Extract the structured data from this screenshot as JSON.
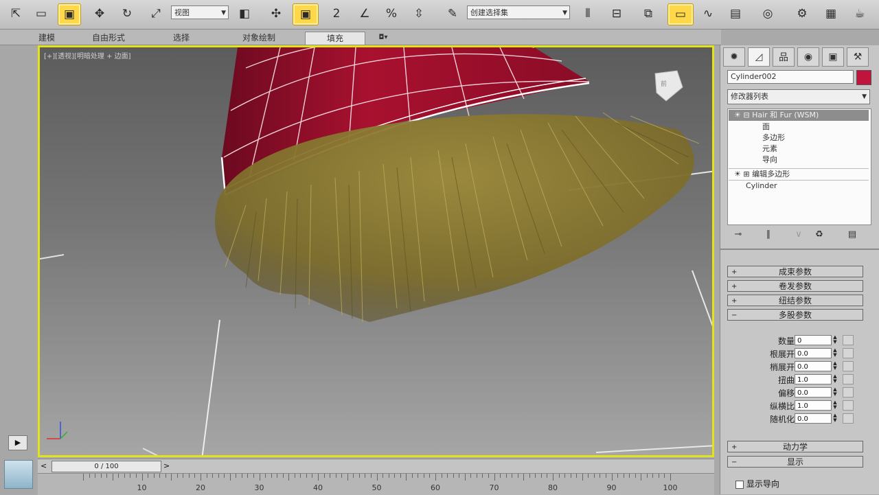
{
  "toolbar": {
    "view_dropdown": "视图",
    "selection_set": "创建选择集",
    "snap_label": "2",
    "percent_label": "%"
  },
  "ribbon": {
    "tabs": [
      "建模",
      "自由形式",
      "选择",
      "对象绘制",
      "填充"
    ]
  },
  "viewport": {
    "label": "[+][透视][明暗处理 + 边面]",
    "viewcube_label": "前"
  },
  "timeline": {
    "frame_display": "0 / 100",
    "ticks": [
      "10",
      "20",
      "30",
      "40",
      "50",
      "60",
      "70",
      "80",
      "90",
      "100"
    ]
  },
  "panel": {
    "object_name": "Cylinder002",
    "object_color": "#c0143c",
    "modifier_list": "修改器列表",
    "stack": {
      "hair_modifier": "Hair 和 Fur (WSM)",
      "sub_items": [
        "面",
        "多边形",
        "元素",
        "导向"
      ],
      "edit_poly": "编辑多边形",
      "base": "Cylinder"
    },
    "rollouts": [
      "成束参数",
      "卷发参数",
      "纽结参数",
      "多股参数"
    ],
    "params": [
      {
        "label": "数量",
        "value": "0"
      },
      {
        "label": "根展开",
        "value": "0.0"
      },
      {
        "label": "梢展开",
        "value": "0.0"
      },
      {
        "label": "扭曲",
        "value": "1.0"
      },
      {
        "label": "偏移",
        "value": "0.0"
      },
      {
        "label": "纵横比",
        "value": "1.0"
      },
      {
        "label": "随机化",
        "value": "0.0"
      }
    ],
    "bottom_rollouts": [
      "动力学",
      "显示"
    ],
    "checkbox_label": "显示导向"
  },
  "colors": {
    "active_yellow": "#ffd84a",
    "viewport_border": "#e3e31a",
    "hat_red": "#a0102e",
    "fur": "#8a7a30"
  }
}
